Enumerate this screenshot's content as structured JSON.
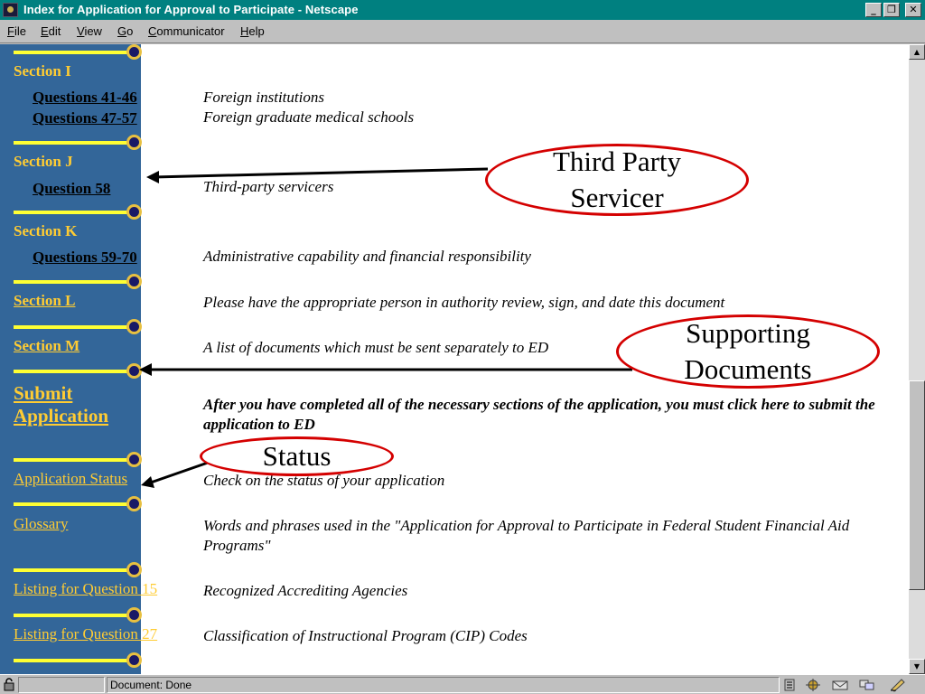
{
  "window": {
    "title": "Index for Application for Approval to Participate - Netscape"
  },
  "menu": [
    {
      "label": "File",
      "key": "F",
      "rest": "ile"
    },
    {
      "label": "Edit",
      "key": "E",
      "rest": "dit"
    },
    {
      "label": "View",
      "key": "V",
      "rest": "iew"
    },
    {
      "label": "Go",
      "key": "G",
      "rest": "o"
    },
    {
      "label": "Communicator",
      "key": "C",
      "rest": "ommunicator"
    },
    {
      "label": "Help",
      "key": "H",
      "rest": "elp"
    }
  ],
  "sidebar": {
    "section_i": "Section I",
    "q41_46": "Questions 41-46",
    "q47_57": "Questions 47-57",
    "section_j": "Section J",
    "q58": "Question 58",
    "section_k": "Section K",
    "q59_70": "Questions 59-70",
    "section_l": "Section L",
    "section_m": "Section M",
    "submit_line1": "Submit",
    "submit_line2": "Application",
    "application_status": "Application Status",
    "glossary": "Glossary",
    "listing_q15": "Listing for Question 15",
    "listing_q27": "Listing for Question 27"
  },
  "descriptions": {
    "q41_46": "Foreign institutions",
    "q47_57": "Foreign graduate medical schools",
    "q58": "Third-party servicers",
    "q59_70": "Administrative capability and financial responsibility",
    "section_l": "Please have the appropriate person in authority review, sign, and date this document",
    "section_m": "A list of documents which must be sent separately to ED",
    "submit": "After you have completed all of the necessary sections of the application, you must click here to submit the application to ED",
    "status": "Check on the status of your application",
    "glossary": "Words and phrases used in the \"Application for Approval to Participate in Federal Student Financial Aid Programs\"",
    "listing_q15": "Recognized Accrediting Agencies",
    "listing_q27": "Classification of Instructional Program (CIP) Codes"
  },
  "callouts": {
    "third_party_line1": "Third Party",
    "third_party_line2": "Servicer",
    "supporting_line1": "Supporting",
    "supporting_line2": "Documents",
    "status": "Status"
  },
  "statusbar": {
    "text": "Document: Done"
  },
  "colors": {
    "titlebar": "#008080",
    "sidebar": "#336699",
    "link_yellow": "#ffcc33",
    "callout_border": "#d40000"
  }
}
